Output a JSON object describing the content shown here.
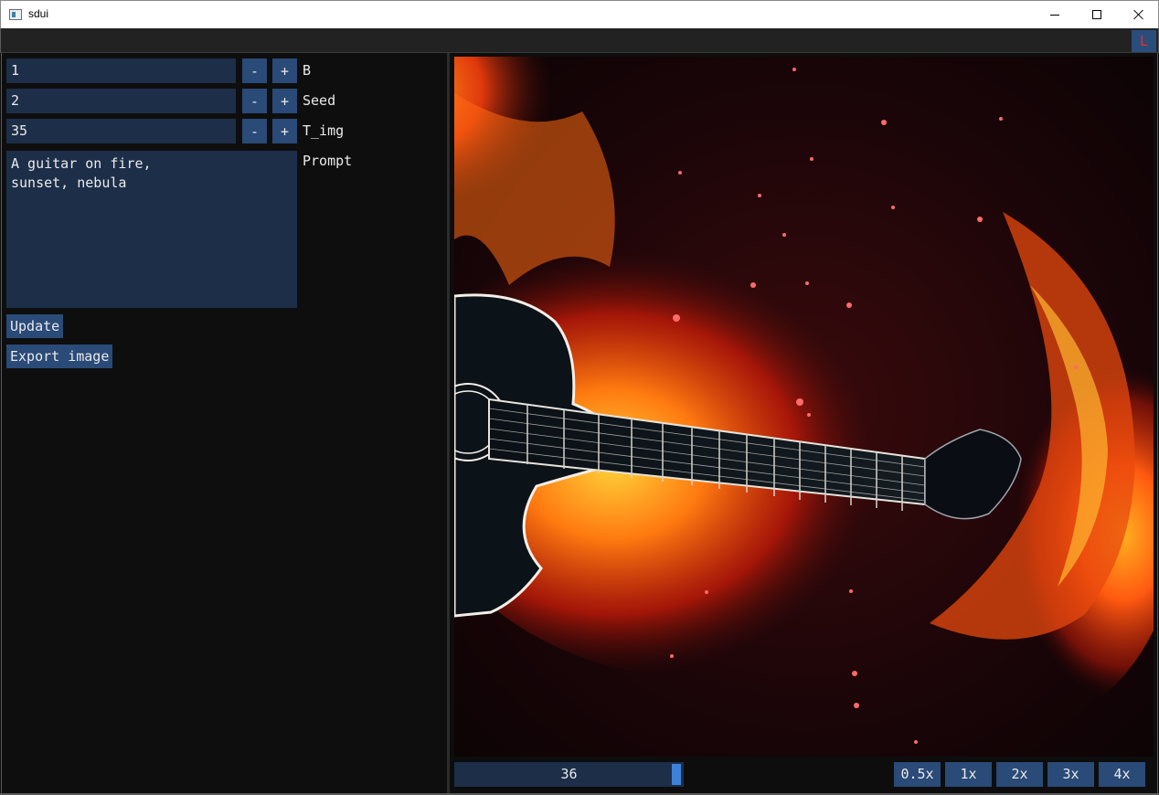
{
  "window": {
    "title": "sdui",
    "minimize_glyph": "minimize-icon",
    "maximize_glyph": "maximize-icon",
    "close_glyph": "close-icon"
  },
  "toolbar": {
    "l_label": "L",
    "l_color": "#e0342a"
  },
  "controls": {
    "batch": {
      "value": "1",
      "minus": "-",
      "plus": "+",
      "label": "B"
    },
    "seed": {
      "value": "2",
      "minus": "-",
      "plus": "+",
      "label": "Seed"
    },
    "t_img": {
      "value": "35",
      "minus": "-",
      "plus": "+",
      "label": "T_img"
    },
    "prompt": {
      "value": "A guitar on fire,\nsunset, nebula",
      "label": "Prompt"
    },
    "update_label": "Update",
    "export_label": "Export image"
  },
  "viewer": {
    "image_description": "guitar-on-fire-nebula",
    "slider_value": "36",
    "zoom_buttons": [
      "0.5x",
      "1x",
      "2x",
      "3x",
      "4x"
    ]
  },
  "colors": {
    "widget_bg": "#1d2e48",
    "button_bg": "#2a4a77",
    "accent": "#3d82d8",
    "panel_bg": "#0e0e0e"
  }
}
